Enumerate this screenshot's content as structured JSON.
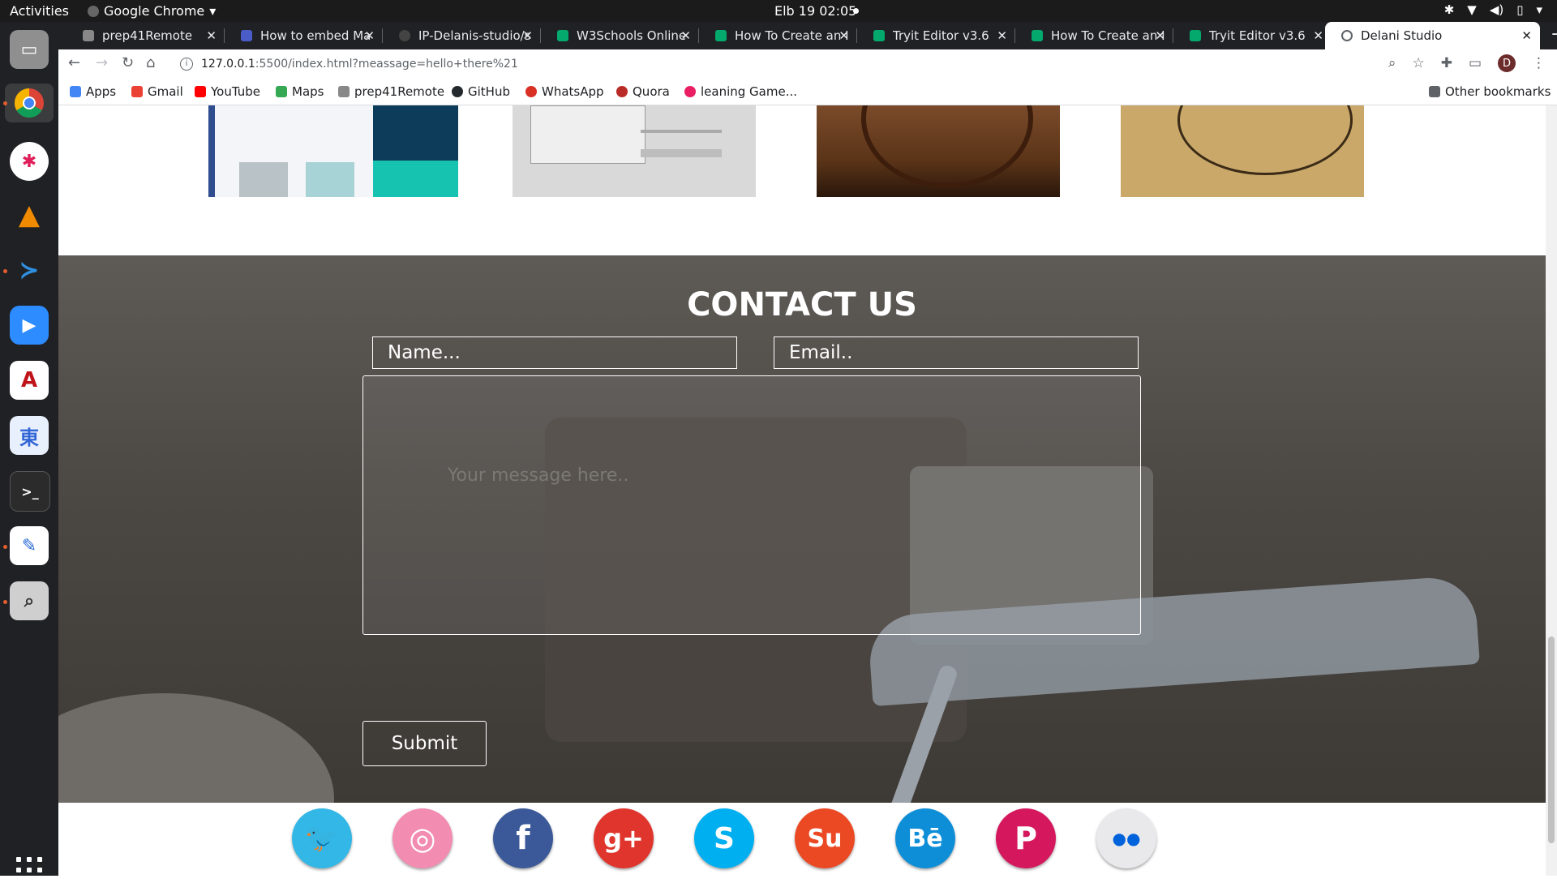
{
  "system": {
    "activities": "Activities",
    "app_name": "Google Chrome",
    "clock": "Elb 19  02:05"
  },
  "tabs": [
    {
      "title": "prep41Remote",
      "color": "#888888"
    },
    {
      "title": "How to embed Ma",
      "color": "#4a5cc7"
    },
    {
      "title": "IP-Delanis-studio/s",
      "color": "#444444"
    },
    {
      "title": "W3Schools Online",
      "color": "#04aa6d"
    },
    {
      "title": "How To Create an I",
      "color": "#04aa6d"
    },
    {
      "title": "Tryit Editor v3.6",
      "color": "#04aa6d"
    },
    {
      "title": "How To Create an I",
      "color": "#04aa6d"
    },
    {
      "title": "Tryit Editor v3.6",
      "color": "#04aa6d"
    },
    {
      "title": "Delani Studio",
      "color": "#5f6368"
    }
  ],
  "omnibox": {
    "host": "127.0.0.1",
    "path": ":5500/index.html?meassage=hello+there%21"
  },
  "bookmarks": [
    {
      "label": "Apps",
      "color": "#4285f4"
    },
    {
      "label": "Gmail",
      "color": "#ea4335"
    },
    {
      "label": "YouTube",
      "color": "#ff0000"
    },
    {
      "label": "Maps",
      "color": "#34a853"
    },
    {
      "label": "prep41Remote",
      "color": "#888888"
    },
    {
      "label": "GitHub",
      "color": "#24292e"
    },
    {
      "label": "WhatsApp",
      "color": "#d93025"
    },
    {
      "label": "Quora",
      "color": "#b92b27"
    },
    {
      "label": "leaning Game...",
      "color": "#e91e63"
    }
  ],
  "other_bookmarks": "Other bookmarks",
  "avatar_letter": "D",
  "contact": {
    "heading": "CONTACT US",
    "name_placeholder": "Name...",
    "email_placeholder": "Email..",
    "message_placeholder": "Your message here..",
    "submit_label": "Submit"
  },
  "social": [
    {
      "name": "twitter",
      "glyph": "🐦",
      "color": "#33b7e6"
    },
    {
      "name": "dribbble",
      "glyph": "◎",
      "color": "#f28cb0"
    },
    {
      "name": "facebook",
      "glyph": "f",
      "color": "#3b5998"
    },
    {
      "name": "google-plus",
      "glyph": "g+",
      "color": "#e0352d"
    },
    {
      "name": "skype",
      "glyph": "S",
      "color": "#00aff0"
    },
    {
      "name": "stumbleupon",
      "glyph": "Su",
      "color": "#eb4924"
    },
    {
      "name": "behance",
      "glyph": "Bē",
      "color": "#0f8ed8"
    },
    {
      "name": "pinterest",
      "glyph": "P",
      "color": "#d5175d"
    },
    {
      "name": "flickr",
      "glyph": "●●",
      "color": "#e9e9ec"
    }
  ]
}
